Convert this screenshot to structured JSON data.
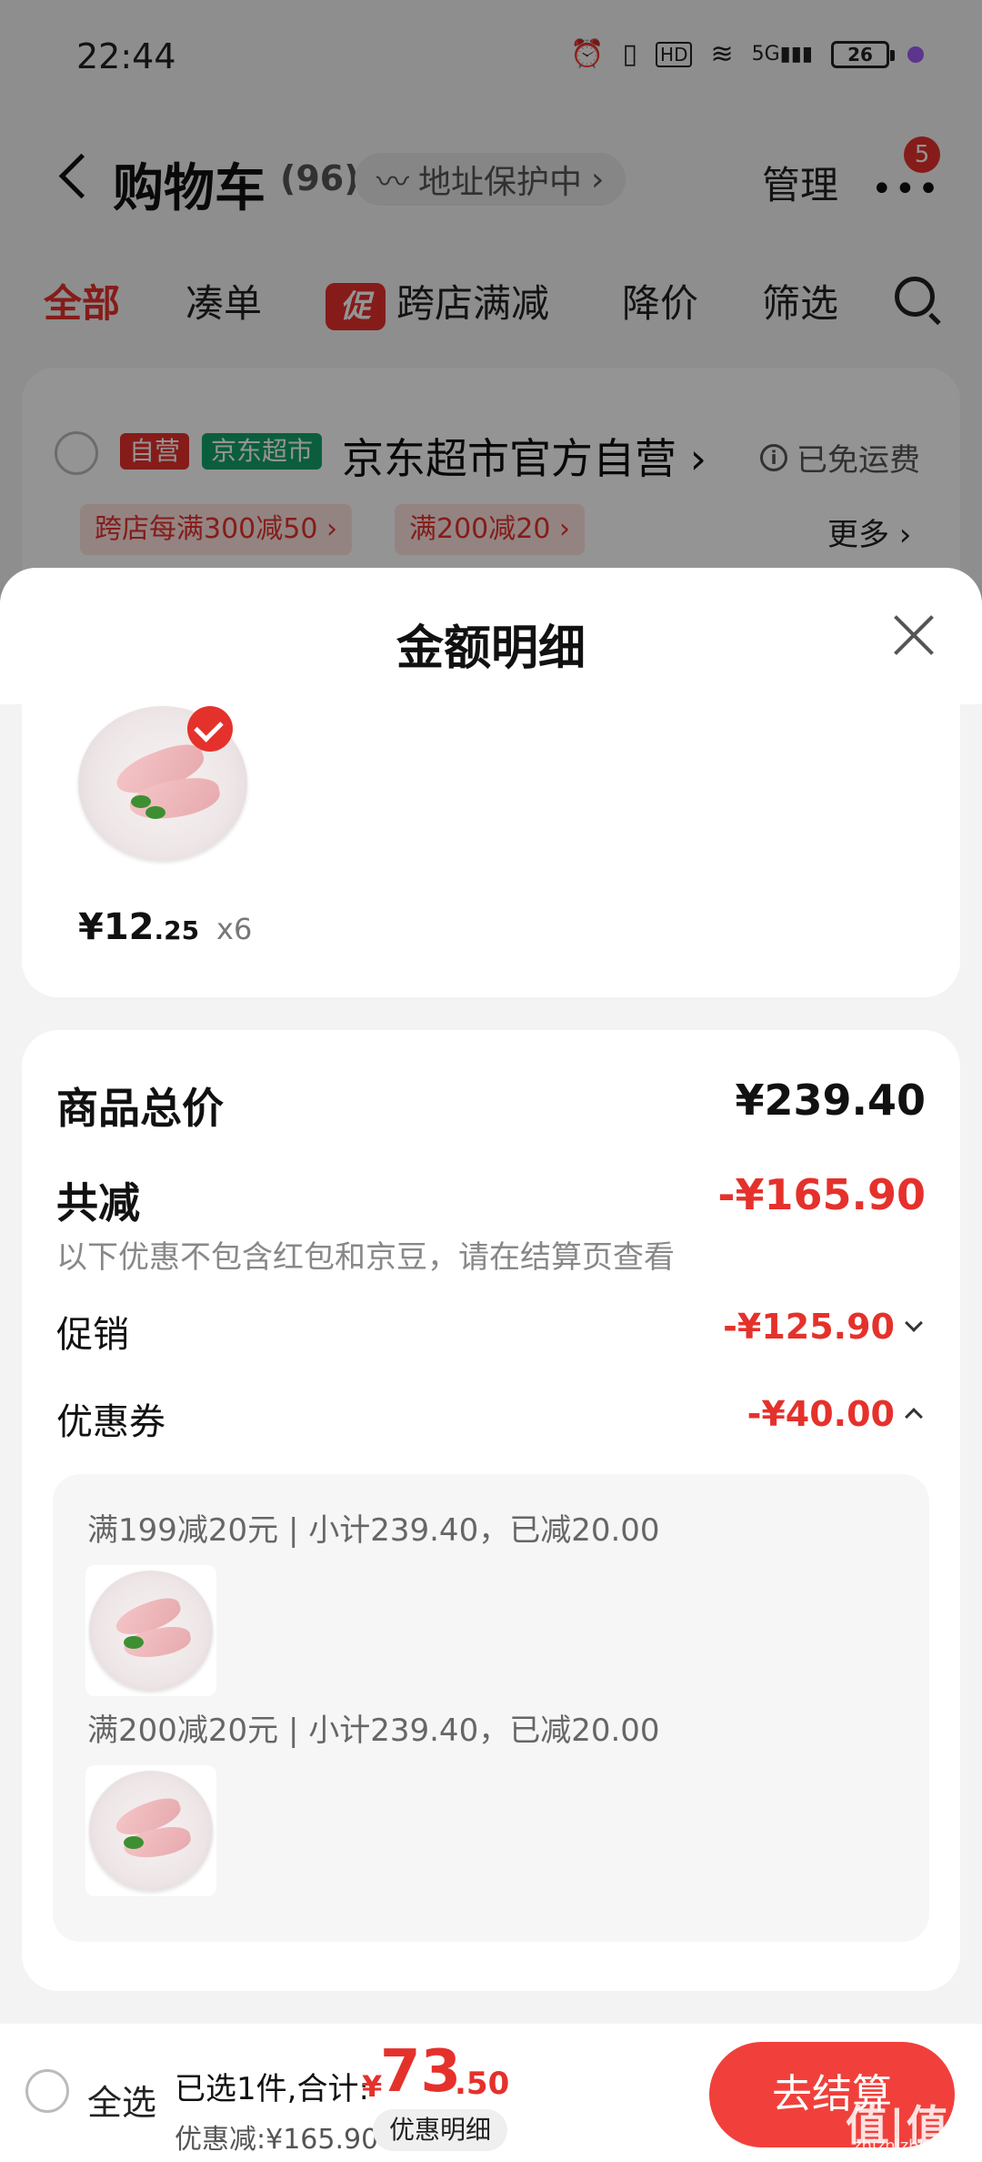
{
  "status": {
    "time": "22:44",
    "battery": "26",
    "network": "5G",
    "hd": "HD"
  },
  "nav": {
    "title": "购物车",
    "count": "(96)",
    "address_protect": "地址保护中",
    "manage": "管理",
    "badge": "5"
  },
  "filters": {
    "all": "全部",
    "combine": "凑单",
    "promo_tag": "促",
    "cross_store": "跨店满减",
    "price_drop": "降价",
    "filter": "筛选"
  },
  "store": {
    "self_tag": "自营",
    "market_tag": "京东超市",
    "name": "京东超市官方自营",
    "shipping": "已免运费",
    "coupons": [
      "跨店每满300减50",
      "满200减20"
    ],
    "more": "更多"
  },
  "sheet": {
    "title": "金额明细",
    "product": {
      "price_int": "¥12",
      "price_dec": ".25",
      "qty": "x6"
    },
    "summary": {
      "total_label": "商品总价",
      "total_value": "¥239.40",
      "discount_label": "共减",
      "discount_value": "-¥165.90",
      "discount_note": "以下优惠不包含红包和京豆，请在结算页查看",
      "promo_label": "促销",
      "promo_value": "-¥125.90",
      "coupon_label": "优惠券",
      "coupon_value": "-¥40.00",
      "coupon_lines": [
        "满199减20元 | 小计239.40，已减20.00",
        "满200减20元 | 小计239.40，已减20.00"
      ]
    }
  },
  "bottom": {
    "select_all": "全选",
    "selected": "已选1件,合计:",
    "currency": "¥",
    "total_int": "73",
    "total_dec": ".50",
    "discount": "优惠减:¥165.90",
    "detail": "优惠明细",
    "checkout": "去结算"
  },
  "watermark": {
    "main": "值|值|值",
    "sub": "zhizhizhi.com"
  },
  "colors": {
    "accent": "#e5312c",
    "market_green": "#14a26a",
    "checkout": "#f1403b"
  },
  "icons": [
    "back-icon",
    "more-icon",
    "search-icon",
    "info-icon",
    "close-icon",
    "check-icon",
    "chevron-down-icon",
    "chevron-up-icon"
  ]
}
